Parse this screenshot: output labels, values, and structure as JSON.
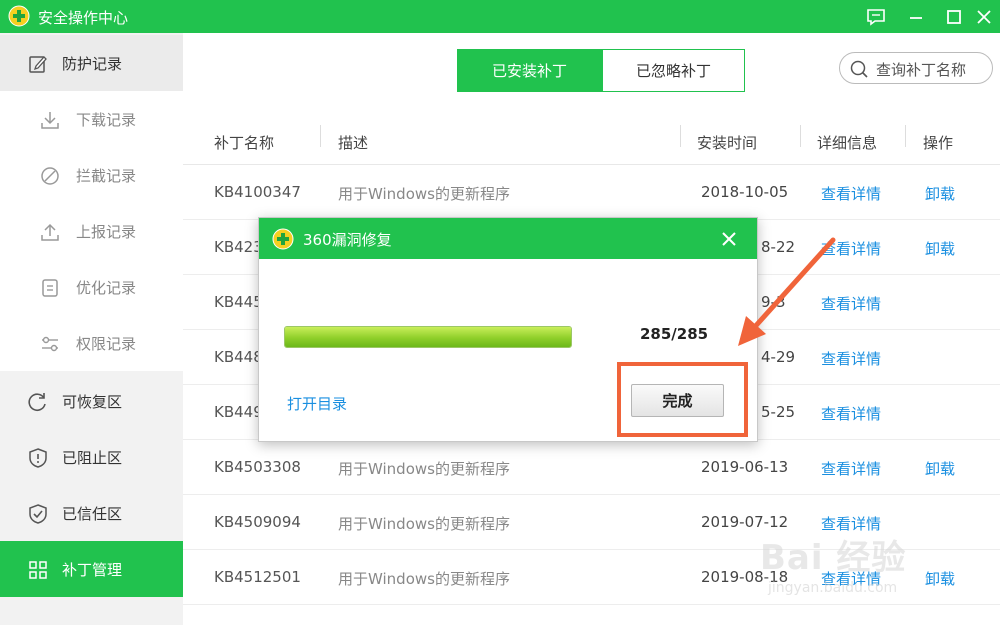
{
  "window": {
    "title": "安全操作中心",
    "controls": [
      "feedback-icon",
      "minimize-icon",
      "maximize-icon",
      "close-icon"
    ]
  },
  "sidebar": {
    "items": [
      {
        "label": "防护记录",
        "icon": "edit-record-icon",
        "kind": "group"
      },
      {
        "label": "下载记录",
        "icon": "download-icon",
        "kind": "sub"
      },
      {
        "label": "拦截记录",
        "icon": "block-icon",
        "kind": "sub"
      },
      {
        "label": "上报记录",
        "icon": "upload-icon",
        "kind": "sub"
      },
      {
        "label": "优化记录",
        "icon": "document-icon",
        "kind": "sub"
      },
      {
        "label": "权限记录",
        "icon": "sliders-icon",
        "kind": "sub"
      },
      {
        "label": "可恢复区",
        "icon": "restore-icon",
        "kind": "group"
      },
      {
        "label": "已阻止区",
        "icon": "shield-alert-icon",
        "kind": "group"
      },
      {
        "label": "已信任区",
        "icon": "shield-check-icon",
        "kind": "group"
      },
      {
        "label": "补丁管理",
        "icon": "grid-icon",
        "kind": "active"
      }
    ]
  },
  "main": {
    "tabs": [
      {
        "label": "已安装补丁",
        "selected": true
      },
      {
        "label": "已忽略补丁",
        "selected": false
      }
    ],
    "search": {
      "placeholder": "查询补丁名称"
    },
    "columns": [
      "补丁名称",
      "描述",
      "安装时间",
      "详细信息",
      "操作"
    ],
    "rows": [
      {
        "name": "KB4100347",
        "desc": "用于Windows的更新程序",
        "date": "2018-10-05",
        "detail": "查看详情",
        "action": "卸载"
      },
      {
        "name": "KB423",
        "desc": "",
        "date": "8-22",
        "detail": "查看详情",
        "action": "卸载"
      },
      {
        "name": "KB445",
        "desc": "",
        "date": "9-3",
        "detail": "查看详情",
        "action": ""
      },
      {
        "name": "KB448",
        "desc": "",
        "date": "4-29",
        "detail": "查看详情",
        "action": ""
      },
      {
        "name": "KB449",
        "desc": "",
        "date": "5-25",
        "detail": "查看详情",
        "action": ""
      },
      {
        "name": "KB4503308",
        "desc": "用于Windows的更新程序",
        "date": "2019-06-13",
        "detail": "查看详情",
        "action": "卸载"
      },
      {
        "name": "KB4509094",
        "desc": "用于Windows的更新程序",
        "date": "2019-07-12",
        "detail": "查看详情",
        "action": ""
      },
      {
        "name": "KB4512501",
        "desc": "用于Windows的更新程序",
        "date": "2019-08-18",
        "detail": "查看详情",
        "action": "卸载"
      }
    ]
  },
  "dialog": {
    "title": "360漏洞修复",
    "progress_fraction": 1.0,
    "progress_text": "285/285",
    "open_dir_label": "打开目录",
    "done_label": "完成"
  },
  "annotation": {
    "color": "#f0643a"
  },
  "watermark": {
    "main": "Bai 经验",
    "sub": "jingyan.baidu.com"
  },
  "colors": {
    "brand": "#21c24e",
    "link": "#1a8fe0"
  }
}
